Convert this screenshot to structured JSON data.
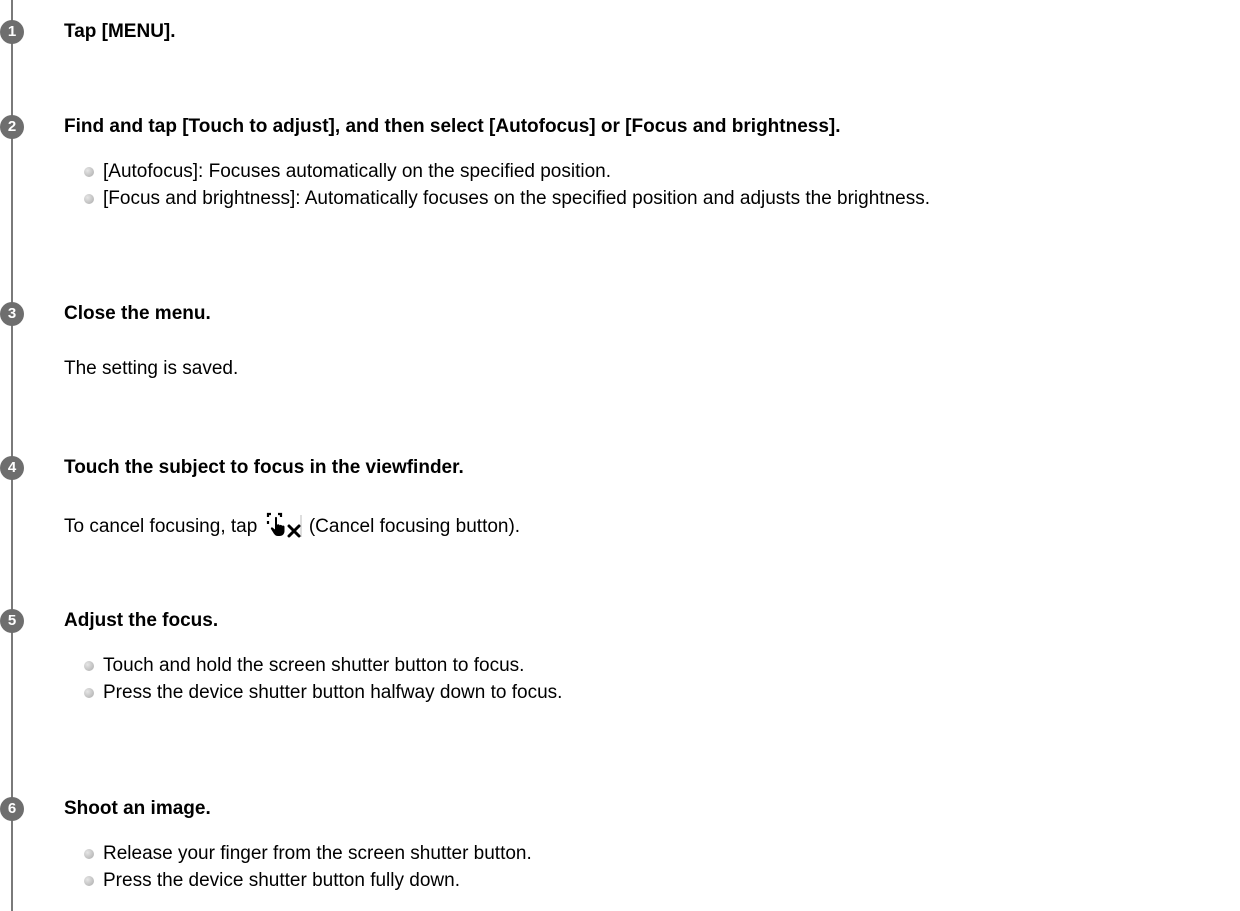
{
  "steps": [
    {
      "number": "1",
      "title": "Tap [MENU]."
    },
    {
      "number": "2",
      "title": "Find and tap [Touch to adjust], and then select [Autofocus] or [Focus and brightness].",
      "bullets": [
        "[Autofocus]: Focuses automatically on the specified position.",
        "[Focus and brightness]: Automatically focuses on the specified position and adjusts the brightness."
      ]
    },
    {
      "number": "3",
      "title": "Close the menu.",
      "text": "The setting is saved."
    },
    {
      "number": "4",
      "title": "Touch the subject to focus in the viewfinder.",
      "text_before_icon": "To cancel focusing, tap",
      "icon": "cancel-focusing-icon",
      "text_after_icon": "(Cancel focusing button)."
    },
    {
      "number": "5",
      "title": "Adjust the focus.",
      "bullets": [
        "Touch and hold the screen shutter button to focus.",
        "Press the device shutter button halfway down to focus."
      ]
    },
    {
      "number": "6",
      "title": "Shoot an image.",
      "bullets": [
        "Release your finger from the screen shutter button.",
        "Press the device shutter button fully down."
      ]
    }
  ],
  "colors": {
    "circle": "#6e6e6e",
    "timeline": "#7a7a7a",
    "text": "#000000"
  }
}
